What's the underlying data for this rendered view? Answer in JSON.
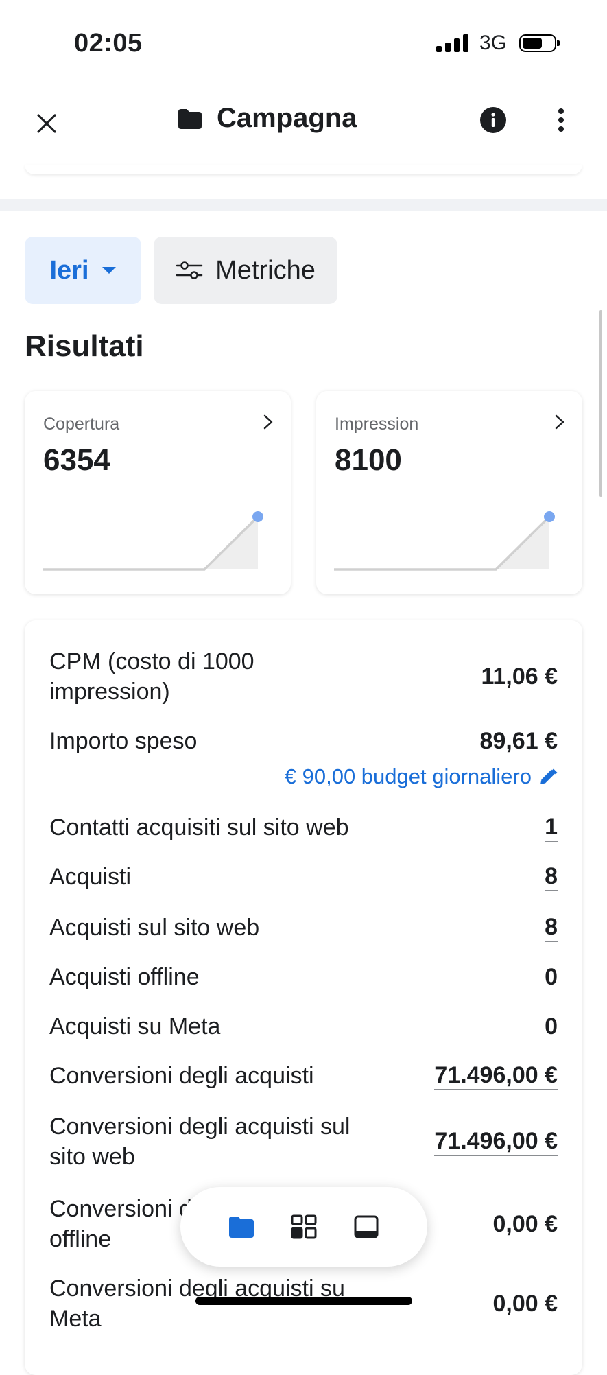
{
  "status_bar": {
    "time": "02:05",
    "network": "3G"
  },
  "header": {
    "title": "Campagna"
  },
  "filters": {
    "period_label": "Ieri",
    "metrics_label": "Metriche"
  },
  "results": {
    "title": "Risultati",
    "cards": [
      {
        "label": "Copertura",
        "value": "6354"
      },
      {
        "label": "Impression",
        "value": "8100"
      }
    ]
  },
  "metrics": {
    "rows": [
      {
        "label": "CPM (costo di 1000 impression)",
        "value": "11,06 €"
      },
      {
        "label": "Importo speso",
        "value": "89,61 €"
      },
      {
        "label": "Contatti acquisiti sul sito web",
        "value": "1"
      },
      {
        "label": "Acquisti",
        "value": "8"
      },
      {
        "label": "Acquisti sul sito web",
        "value": "8"
      },
      {
        "label": "Acquisti offline",
        "value": "0"
      },
      {
        "label": "Acquisti su Meta",
        "value": "0"
      },
      {
        "label": "Conversioni degli acquisti",
        "value": "71.496,00 €"
      },
      {
        "label": "Conversioni degli acquisti sul sito web",
        "value": "71.496,00 €"
      },
      {
        "label": "Conversioni degli acquisti offline",
        "value": "0,00 €"
      },
      {
        "label": "Conversioni degli acquisti su Meta",
        "value": "0,00 €"
      }
    ],
    "budget_link": "€ 90,00 budget giornaliero"
  },
  "colors": {
    "accent": "#1a6ed8",
    "accent_bg": "#e7f0fd",
    "chart_dot": "#7aa7f0"
  },
  "icons": {
    "close": "close-icon",
    "folder": "folder-icon",
    "info": "info-icon",
    "more": "more-vertical-icon",
    "dropdown": "caret-down-icon",
    "sliders": "sliders-icon",
    "chevron": "chevron-right-icon",
    "edit": "pencil-icon",
    "nav": [
      "folder-icon",
      "grid-icon",
      "laptop-icon"
    ]
  }
}
